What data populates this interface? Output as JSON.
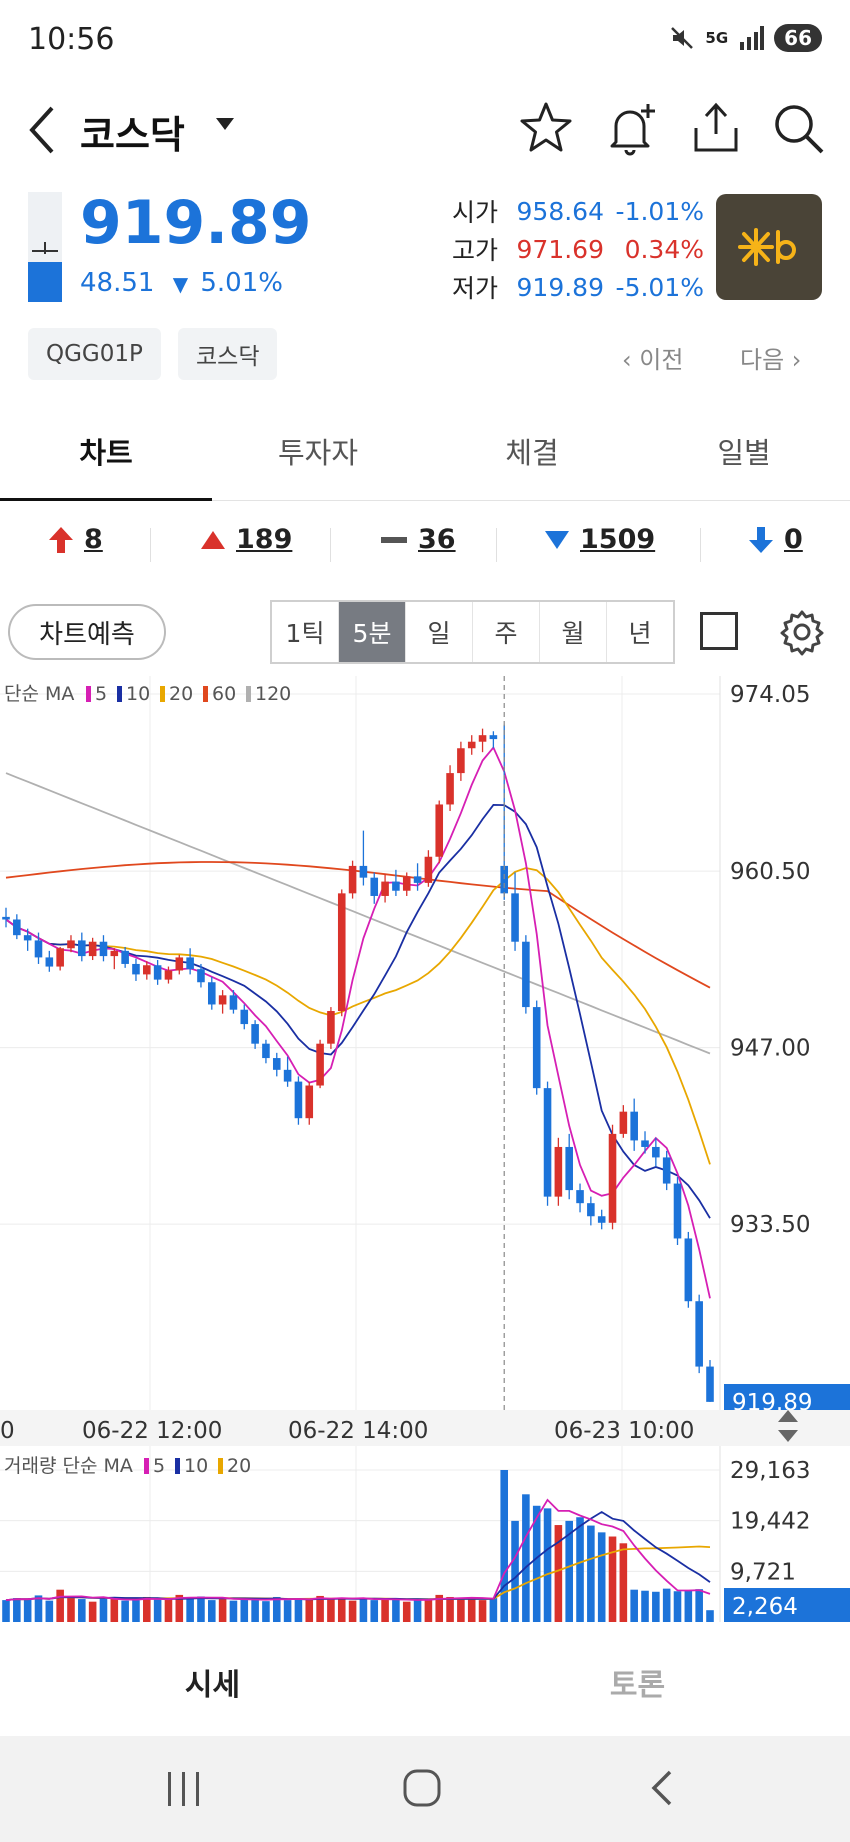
{
  "status_bar": {
    "time": "10:56",
    "network": "5G",
    "battery": "66"
  },
  "header": {
    "title": "코스닥"
  },
  "quote": {
    "price": "919.89",
    "change": "48.51",
    "change_pct": "5.01%",
    "open_label": "시가",
    "open": "958.64",
    "open_pct": "-1.01%",
    "high_label": "고가",
    "high": "971.69",
    "high_pct": "0.34%",
    "low_label": "저가",
    "low": "919.89",
    "low_pct": "-5.01%",
    "logo_text": "KB"
  },
  "chips": [
    "QGG01P",
    "코스닥"
  ],
  "nav": {
    "prev": "이전",
    "next": "다음"
  },
  "tabs": [
    {
      "label": "차트"
    },
    {
      "label": "투자자"
    },
    {
      "label": "체결"
    },
    {
      "label": "일별"
    }
  ],
  "counts": {
    "upper_limit": "8",
    "rise": "189",
    "unchanged": "36",
    "fall": "1509",
    "lower_limit": "0"
  },
  "toolbar": {
    "predict_label": "차트예측",
    "periods": [
      "1틱",
      "5분",
      "일",
      "주",
      "월",
      "년"
    ],
    "selected_period": "5분"
  },
  "colors": {
    "up": "#d9322b",
    "down": "#1c73d9",
    "ma5": "#d61fb4",
    "ma10": "#1a2fa3",
    "ma20": "#e8a700",
    "ma60": "#e0481e",
    "ma120": "#b0b0b0"
  },
  "legend": {
    "price": {
      "label": "단순 MA",
      "items": [
        "5",
        "10",
        "20",
        "60",
        "120"
      ]
    },
    "volume": {
      "label": "거래량 단순 MA",
      "items": [
        "5",
        "10",
        "20"
      ]
    }
  },
  "chart_data": {
    "type": "candlestick",
    "price_axis_ticks": [
      "974.05",
      "960.50",
      "947.00",
      "933.50"
    ],
    "current_price_label": "919.89",
    "x_tick_labels": [
      "0",
      "06-22 12:00",
      "06-22 14:00",
      "06-23 10:00"
    ],
    "volume_axis_ticks": [
      "29,163",
      "19,442",
      "9,721"
    ],
    "current_volume_label": "2,264",
    "ylim": [
      919.89,
      974.05
    ],
    "ohlc": [
      [
        957.0,
        957.7,
        956.2,
        956.8
      ],
      [
        956.8,
        957.2,
        955.3,
        955.6
      ],
      [
        955.6,
        956.1,
        954.4,
        955.2
      ],
      [
        955.2,
        955.8,
        953.4,
        953.9
      ],
      [
        953.9,
        954.4,
        952.8,
        953.2
      ],
      [
        953.2,
        954.7,
        952.9,
        954.6
      ],
      [
        954.6,
        955.6,
        954.3,
        955.2
      ],
      [
        955.2,
        955.8,
        953.6,
        954.0
      ],
      [
        954.0,
        955.4,
        953.7,
        955.1
      ],
      [
        955.1,
        955.6,
        953.6,
        954.0
      ],
      [
        954.0,
        954.6,
        953.0,
        954.4
      ],
      [
        954.4,
        954.7,
        953.1,
        953.4
      ],
      [
        953.4,
        953.8,
        952.1,
        952.6
      ],
      [
        952.6,
        953.6,
        952.2,
        953.3
      ],
      [
        953.3,
        953.7,
        951.8,
        952.2
      ],
      [
        952.2,
        953.2,
        951.9,
        952.9
      ],
      [
        952.9,
        954.1,
        952.6,
        953.9
      ],
      [
        953.9,
        954.6,
        952.6,
        953.0
      ],
      [
        953.0,
        953.4,
        951.6,
        952.0
      ],
      [
        952.0,
        952.4,
        949.9,
        950.3
      ],
      [
        950.3,
        951.4,
        949.6,
        951.0
      ],
      [
        951.0,
        951.4,
        949.6,
        949.9
      ],
      [
        949.9,
        950.3,
        948.4,
        948.8
      ],
      [
        948.8,
        949.1,
        946.9,
        947.3
      ],
      [
        947.3,
        947.6,
        945.8,
        946.2
      ],
      [
        946.2,
        946.6,
        944.8,
        945.3
      ],
      [
        945.3,
        946.3,
        944.0,
        944.4
      ],
      [
        944.4,
        944.8,
        941.1,
        941.6
      ],
      [
        941.6,
        944.4,
        941.1,
        944.1
      ],
      [
        944.1,
        947.6,
        943.9,
        947.3
      ],
      [
        947.3,
        950.1,
        946.9,
        949.8
      ],
      [
        949.8,
        959.1,
        949.4,
        958.8
      ],
      [
        958.8,
        961.3,
        958.4,
        960.9
      ],
      [
        960.9,
        963.6,
        959.4,
        960.0
      ],
      [
        960.0,
        960.4,
        958.0,
        958.6
      ],
      [
        958.6,
        960.3,
        958.1,
        959.7
      ],
      [
        959.7,
        960.6,
        958.6,
        959.0
      ],
      [
        959.0,
        960.4,
        958.6,
        960.1
      ],
      [
        960.1,
        961.1,
        959.0,
        959.6
      ],
      [
        959.6,
        962.1,
        959.3,
        961.6
      ],
      [
        961.6,
        965.9,
        961.1,
        965.6
      ],
      [
        965.6,
        968.6,
        965.1,
        968.0
      ],
      [
        968.0,
        970.4,
        967.4,
        969.9
      ],
      [
        969.9,
        970.9,
        969.4,
        970.4
      ],
      [
        970.4,
        971.4,
        969.6,
        970.9
      ],
      [
        970.9,
        971.2,
        969.9,
        970.6
      ],
      [
        960.9,
        971.7,
        958.3,
        958.8
      ],
      [
        958.8,
        960.4,
        954.4,
        955.1
      ],
      [
        955.1,
        955.6,
        949.6,
        950.1
      ],
      [
        950.1,
        950.6,
        943.4,
        943.9
      ],
      [
        943.9,
        944.4,
        934.9,
        935.6
      ],
      [
        935.6,
        940.1,
        934.9,
        939.4
      ],
      [
        939.4,
        940.4,
        935.4,
        936.1
      ],
      [
        936.1,
        936.6,
        934.4,
        935.1
      ],
      [
        935.1,
        935.6,
        933.4,
        934.1
      ],
      [
        934.1,
        934.6,
        933.1,
        933.6
      ],
      [
        933.6,
        941.1,
        933.1,
        940.4
      ],
      [
        940.4,
        942.6,
        940.1,
        942.1
      ],
      [
        942.1,
        943.1,
        939.1,
        939.9
      ],
      [
        939.9,
        940.6,
        938.9,
        939.4
      ],
      [
        939.4,
        940.1,
        937.9,
        938.6
      ],
      [
        938.6,
        939.1,
        936.1,
        936.6
      ],
      [
        936.6,
        937.1,
        931.9,
        932.4
      ],
      [
        932.4,
        932.9,
        927.1,
        927.6
      ],
      [
        927.6,
        928.1,
        922.1,
        922.6
      ],
      [
        922.6,
        923.1,
        919.9,
        919.9
      ]
    ],
    "volume": [
      4200,
      4600,
      4300,
      5100,
      4100,
      6200,
      4800,
      4400,
      3900,
      4500,
      4700,
      4100,
      4200,
      4800,
      4300,
      4500,
      5200,
      4600,
      4900,
      4200,
      4400,
      4100,
      4300,
      4600,
      4000,
      4800,
      4200,
      4500,
      4300,
      5000,
      4400,
      4700,
      4100,
      4600,
      4200,
      4300,
      4500,
      3900,
      4200,
      4400,
      5200,
      4800,
      4300,
      4500,
      4200,
      4600,
      29163,
      19400,
      24500,
      22300,
      21800,
      18600,
      19400,
      20100,
      18500,
      17200,
      16400,
      15100,
      6200,
      6000,
      5800,
      6400,
      5900,
      6100,
      6300,
      2264
    ]
  }
}
